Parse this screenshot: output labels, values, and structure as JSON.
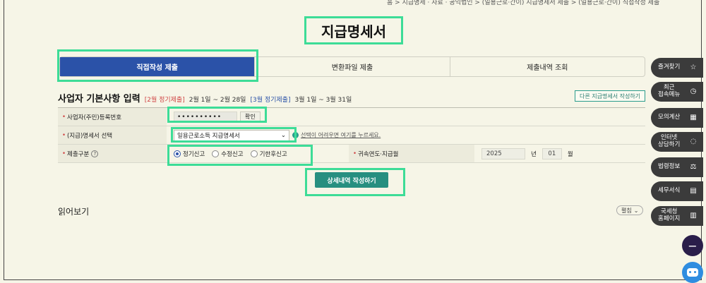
{
  "breadcrumb": "홈 > 지급명세 · 자료 · 공익법인 > (일용근로·간이) 지급명세서 제출 > (일용근로·간이) 직접작성 제출",
  "page_title": "지급명세서",
  "tabs": [
    {
      "label": "직접작성 제출",
      "active": true
    },
    {
      "label": "변환파일 제출",
      "active": false
    },
    {
      "label": "제출내역 조회",
      "active": false
    }
  ],
  "section": {
    "title": "사업자 기본사항 입력",
    "period1_tag": "[2월 정기제출]",
    "period1_text": "2월 1일 ~ 2월 28일",
    "period2_tag": "[3월 정기제출]",
    "period2_text": "3월 1일 ~ 3월 31일",
    "other_button": "다른 지급명세서 작성하기"
  },
  "form": {
    "reg_label": "사업자(주민)등록번호",
    "reg_value": "••••••••••",
    "confirm_button": "확인",
    "type_label": "(지급)명세서 선택",
    "type_value": "일용근로소득 지급명세서",
    "type_hint": "선택이 어려우면 여기를 누르세요.",
    "submit_label": "제출구분",
    "help_icon": "?",
    "radios": [
      {
        "label": "정기신고",
        "checked": true
      },
      {
        "label": "수정신고",
        "checked": false
      },
      {
        "label": "기한후신고",
        "checked": false
      }
    ],
    "year_label": "귀속연도·지급월",
    "year_value": "2025",
    "year_unit": "년",
    "month_value": "01",
    "month_unit": "월"
  },
  "detail_button": "상세내역 작성하기",
  "read_section": {
    "title": "읽어보기",
    "expand_button": "펼침"
  },
  "quick_menu": [
    {
      "label": "즐겨찾기",
      "icon": "star-icon",
      "glyph": "☆"
    },
    {
      "label": "최근\n접속메뉴",
      "icon": "clock-icon",
      "glyph": "◷"
    },
    {
      "label": "모의계산",
      "icon": "calculator-icon",
      "glyph": "▦"
    },
    {
      "label": "인터넷\n상담하기",
      "icon": "chat-icon",
      "glyph": "◌"
    },
    {
      "label": "법령정보",
      "icon": "law-icon",
      "glyph": "⚖"
    },
    {
      "label": "세무서식",
      "icon": "form-icon",
      "glyph": "▤"
    },
    {
      "label": "국세청\n홈페이지",
      "icon": "building-icon",
      "glyph": "▥"
    }
  ],
  "minus_glyph": "−",
  "colors": {
    "accent_blue": "#2b52a8",
    "teal": "#278f80",
    "highlight": "#3ddc97",
    "background": "#f6f5e7"
  }
}
